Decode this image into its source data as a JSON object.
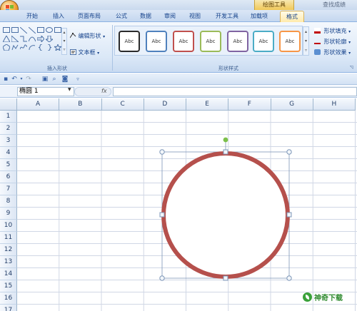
{
  "title_bar": {
    "context_group": "绘图工具",
    "find_label": "查找成绩"
  },
  "tabs": [
    "开始",
    "插入",
    "页面布局",
    "公式",
    "数据",
    "审阅",
    "视图",
    "开发工具",
    "加载项",
    "格式"
  ],
  "active_tab": "格式",
  "ribbon": {
    "insert_shapes": {
      "label": "插入形状",
      "edit_shape": "编辑形状",
      "text_box": "文本框"
    },
    "shape_styles": {
      "label": "形状样式",
      "samples": [
        {
          "text": "Abc",
          "color": "#2b2b2b"
        },
        {
          "text": "Abc",
          "color": "#4f81bd"
        },
        {
          "text": "Abc",
          "color": "#c0504d"
        },
        {
          "text": "Abc",
          "color": "#9bbb59"
        },
        {
          "text": "Abc",
          "color": "#8064a2"
        },
        {
          "text": "Abc",
          "color": "#4bacc6"
        },
        {
          "text": "Abc",
          "color": "#f79646"
        }
      ],
      "fill": "形状填充",
      "outline": "形状轮廓",
      "effects": "形状效果"
    }
  },
  "formula_bar": {
    "name_box": "椭圆 1",
    "fx": "fx",
    "formula": ""
  },
  "sheet": {
    "columns": [
      "A",
      "B",
      "C",
      "D",
      "E",
      "F",
      "G",
      "H"
    ],
    "rows": [
      "1",
      "2",
      "3",
      "4",
      "5",
      "6",
      "7",
      "8",
      "9",
      "10",
      "11",
      "12",
      "13",
      "14",
      "15",
      "16",
      "17"
    ]
  },
  "shape": {
    "type": "ellipse",
    "outline_color": "#b5504c",
    "handle_color": "#7cc04a"
  },
  "watermark": "神奇下载"
}
